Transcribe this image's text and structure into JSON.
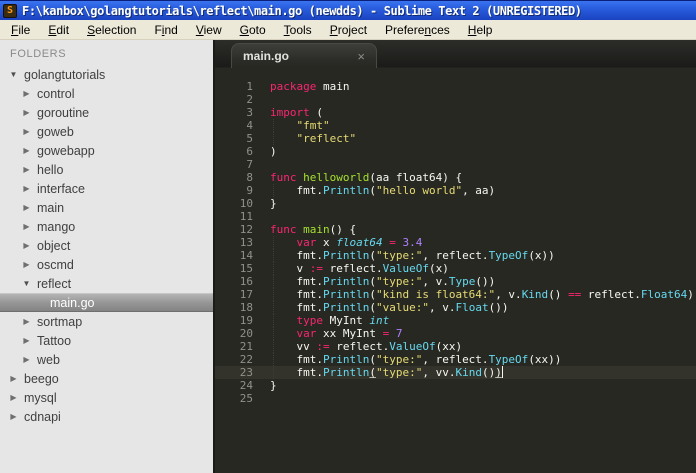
{
  "window": {
    "title": "F:\\kanbox\\golangtutorials\\reflect\\main.go (newdds) - Sublime Text 2 (UNREGISTERED)",
    "icon_letter": "S"
  },
  "menu": {
    "items": [
      {
        "label": "File",
        "u": 0
      },
      {
        "label": "Edit",
        "u": 0
      },
      {
        "label": "Selection",
        "u": 0
      },
      {
        "label": "Find",
        "u": 1
      },
      {
        "label": "View",
        "u": 0
      },
      {
        "label": "Goto",
        "u": 0
      },
      {
        "label": "Tools",
        "u": 0
      },
      {
        "label": "Project",
        "u": 0
      },
      {
        "label": "Preferences",
        "u": 7
      },
      {
        "label": "Help",
        "u": 0
      }
    ]
  },
  "sidebar": {
    "header": "FOLDERS",
    "items": [
      {
        "label": "golangtutorials",
        "depth": 0,
        "kind": "folder",
        "expanded": true
      },
      {
        "label": "control",
        "depth": 1,
        "kind": "folder",
        "expanded": false
      },
      {
        "label": "goroutine",
        "depth": 1,
        "kind": "folder",
        "expanded": false
      },
      {
        "label": "goweb",
        "depth": 1,
        "kind": "folder",
        "expanded": false
      },
      {
        "label": "gowebapp",
        "depth": 1,
        "kind": "folder",
        "expanded": false
      },
      {
        "label": "hello",
        "depth": 1,
        "kind": "folder",
        "expanded": false
      },
      {
        "label": "interface",
        "depth": 1,
        "kind": "folder",
        "expanded": false
      },
      {
        "label": "main",
        "depth": 1,
        "kind": "folder",
        "expanded": false
      },
      {
        "label": "mango",
        "depth": 1,
        "kind": "folder",
        "expanded": false
      },
      {
        "label": "object",
        "depth": 1,
        "kind": "folder",
        "expanded": false
      },
      {
        "label": "oscmd",
        "depth": 1,
        "kind": "folder",
        "expanded": false
      },
      {
        "label": "reflect",
        "depth": 1,
        "kind": "folder",
        "expanded": true
      },
      {
        "label": "main.go",
        "depth": 2,
        "kind": "file",
        "selected": true
      },
      {
        "label": "sortmap",
        "depth": 1,
        "kind": "folder",
        "expanded": false
      },
      {
        "label": "Tattoo",
        "depth": 1,
        "kind": "folder",
        "expanded": false
      },
      {
        "label": "web",
        "depth": 1,
        "kind": "folder",
        "expanded": false
      },
      {
        "label": "beego",
        "depth": 0,
        "kind": "folder",
        "expanded": false
      },
      {
        "label": "mysql",
        "depth": 0,
        "kind": "folder",
        "expanded": false
      },
      {
        "label": "cdnapi",
        "depth": 0,
        "kind": "folder",
        "expanded": false
      }
    ]
  },
  "editor": {
    "tab": {
      "label": "main.go",
      "close_glyph": "×"
    },
    "language": "go",
    "cursor_line": 23,
    "lines": [
      {
        "n": 1,
        "spans": [
          {
            "c": "k",
            "t": "package"
          },
          {
            "c": "p",
            "t": " main"
          }
        ]
      },
      {
        "n": 2,
        "spans": []
      },
      {
        "n": 3,
        "spans": [
          {
            "c": "k",
            "t": "import"
          },
          {
            "c": "p",
            "t": " ("
          }
        ]
      },
      {
        "n": 4,
        "spans": [
          {
            "c": "p",
            "t": "    "
          },
          {
            "c": "s",
            "t": "\"fmt\""
          }
        ]
      },
      {
        "n": 5,
        "spans": [
          {
            "c": "p",
            "t": "    "
          },
          {
            "c": "s",
            "t": "\"reflect\""
          }
        ]
      },
      {
        "n": 6,
        "spans": [
          {
            "c": "p",
            "t": ")"
          }
        ]
      },
      {
        "n": 7,
        "spans": []
      },
      {
        "n": 8,
        "spans": [
          {
            "c": "k",
            "t": "func"
          },
          {
            "c": "p",
            "t": " "
          },
          {
            "c": "f",
            "t": "helloworld"
          },
          {
            "c": "p",
            "t": "(aa float64) {"
          }
        ]
      },
      {
        "n": 9,
        "spans": [
          {
            "c": "p",
            "t": "    fmt."
          },
          {
            "c": "b",
            "t": "Println"
          },
          {
            "c": "p",
            "t": "("
          },
          {
            "c": "s",
            "t": "\"hello world\""
          },
          {
            "c": "p",
            "t": ", aa)"
          }
        ]
      },
      {
        "n": 10,
        "spans": [
          {
            "c": "p",
            "t": "}"
          }
        ]
      },
      {
        "n": 11,
        "spans": []
      },
      {
        "n": 12,
        "spans": [
          {
            "c": "k",
            "t": "func"
          },
          {
            "c": "p",
            "t": " "
          },
          {
            "c": "f",
            "t": "main"
          },
          {
            "c": "p",
            "t": "() {"
          }
        ]
      },
      {
        "n": 13,
        "spans": [
          {
            "c": "p",
            "t": "    "
          },
          {
            "c": "k",
            "t": "var"
          },
          {
            "c": "p",
            "t": " x "
          },
          {
            "c": "t",
            "t": "float64"
          },
          {
            "c": "p",
            "t": " "
          },
          {
            "c": "k",
            "t": "="
          },
          {
            "c": "p",
            "t": " "
          },
          {
            "c": "n",
            "t": "3.4"
          }
        ]
      },
      {
        "n": 14,
        "spans": [
          {
            "c": "p",
            "t": "    fmt."
          },
          {
            "c": "b",
            "t": "Println"
          },
          {
            "c": "p",
            "t": "("
          },
          {
            "c": "s",
            "t": "\"type:\""
          },
          {
            "c": "p",
            "t": ", reflect."
          },
          {
            "c": "b",
            "t": "TypeOf"
          },
          {
            "c": "p",
            "t": "(x))"
          }
        ]
      },
      {
        "n": 15,
        "spans": [
          {
            "c": "p",
            "t": "    v "
          },
          {
            "c": "k",
            "t": ":="
          },
          {
            "c": "p",
            "t": " reflect."
          },
          {
            "c": "b",
            "t": "ValueOf"
          },
          {
            "c": "p",
            "t": "(x)"
          }
        ]
      },
      {
        "n": 16,
        "spans": [
          {
            "c": "p",
            "t": "    fmt."
          },
          {
            "c": "b",
            "t": "Println"
          },
          {
            "c": "p",
            "t": "("
          },
          {
            "c": "s",
            "t": "\"type:\""
          },
          {
            "c": "p",
            "t": ", v."
          },
          {
            "c": "b",
            "t": "Type"
          },
          {
            "c": "p",
            "t": "())"
          }
        ]
      },
      {
        "n": 17,
        "spans": [
          {
            "c": "p",
            "t": "    fmt."
          },
          {
            "c": "b",
            "t": "Println"
          },
          {
            "c": "p",
            "t": "("
          },
          {
            "c": "s",
            "t": "\"kind is float64:\""
          },
          {
            "c": "p",
            "t": ", v."
          },
          {
            "c": "b",
            "t": "Kind"
          },
          {
            "c": "p",
            "t": "() "
          },
          {
            "c": "k",
            "t": "=="
          },
          {
            "c": "p",
            "t": " reflect."
          },
          {
            "c": "b",
            "t": "Float64"
          },
          {
            "c": "p",
            "t": ")"
          }
        ]
      },
      {
        "n": 18,
        "spans": [
          {
            "c": "p",
            "t": "    fmt."
          },
          {
            "c": "b",
            "t": "Println"
          },
          {
            "c": "p",
            "t": "("
          },
          {
            "c": "s",
            "t": "\"value:\""
          },
          {
            "c": "p",
            "t": ", v."
          },
          {
            "c": "b",
            "t": "Float"
          },
          {
            "c": "p",
            "t": "())"
          }
        ]
      },
      {
        "n": 19,
        "spans": [
          {
            "c": "p",
            "t": "    "
          },
          {
            "c": "k",
            "t": "type"
          },
          {
            "c": "p",
            "t": " MyInt "
          },
          {
            "c": "t",
            "t": "int"
          }
        ]
      },
      {
        "n": 20,
        "spans": [
          {
            "c": "p",
            "t": "    "
          },
          {
            "c": "k",
            "t": "var"
          },
          {
            "c": "p",
            "t": " xx MyInt "
          },
          {
            "c": "k",
            "t": "="
          },
          {
            "c": "p",
            "t": " "
          },
          {
            "c": "n",
            "t": "7"
          }
        ]
      },
      {
        "n": 21,
        "spans": [
          {
            "c": "p",
            "t": "    vv "
          },
          {
            "c": "k",
            "t": ":="
          },
          {
            "c": "p",
            "t": " reflect."
          },
          {
            "c": "b",
            "t": "ValueOf"
          },
          {
            "c": "p",
            "t": "(xx)"
          }
        ]
      },
      {
        "n": 22,
        "spans": [
          {
            "c": "p",
            "t": "    fmt."
          },
          {
            "c": "b",
            "t": "Println"
          },
          {
            "c": "p",
            "t": "("
          },
          {
            "c": "s",
            "t": "\"type:\""
          },
          {
            "c": "p",
            "t": ", reflect."
          },
          {
            "c": "b",
            "t": "TypeOf"
          },
          {
            "c": "p",
            "t": "(xx))"
          }
        ]
      },
      {
        "n": 23,
        "spans": [
          {
            "c": "p",
            "t": "    fmt."
          },
          {
            "c": "b",
            "t": "Println"
          },
          {
            "c": "p",
            "t": "(",
            "u": true
          },
          {
            "c": "s",
            "t": "\"type:\""
          },
          {
            "c": "p",
            "t": ", vv."
          },
          {
            "c": "b",
            "t": "Kind"
          },
          {
            "c": "p",
            "t": "()"
          },
          {
            "c": "p",
            "t": ")",
            "u": true
          }
        ]
      },
      {
        "n": 24,
        "spans": [
          {
            "c": "p",
            "t": "}"
          }
        ]
      },
      {
        "n": 25,
        "spans": []
      }
    ]
  },
  "colors": {
    "titlebar_blue": "#2a5fe0",
    "menubar_bg": "#ece9d8",
    "sidebar_bg": "#e6e6e6",
    "sidebar_text": "#404040",
    "sidebar_header_text": "#8a8a8a",
    "selection_gradient_top": "#b4b4b4",
    "selection_gradient_bottom": "#848484",
    "editor_bg": "#272822",
    "active_line_bg": "#33332b",
    "gutter_text": "#90918b",
    "keyword": "#f92672",
    "function_def": "#a6e22e",
    "type_italic": "#66d9ef",
    "support_function": "#66d9ef",
    "string": "#e6db74",
    "number": "#ae81ff",
    "plain": "#f8f8f2"
  }
}
